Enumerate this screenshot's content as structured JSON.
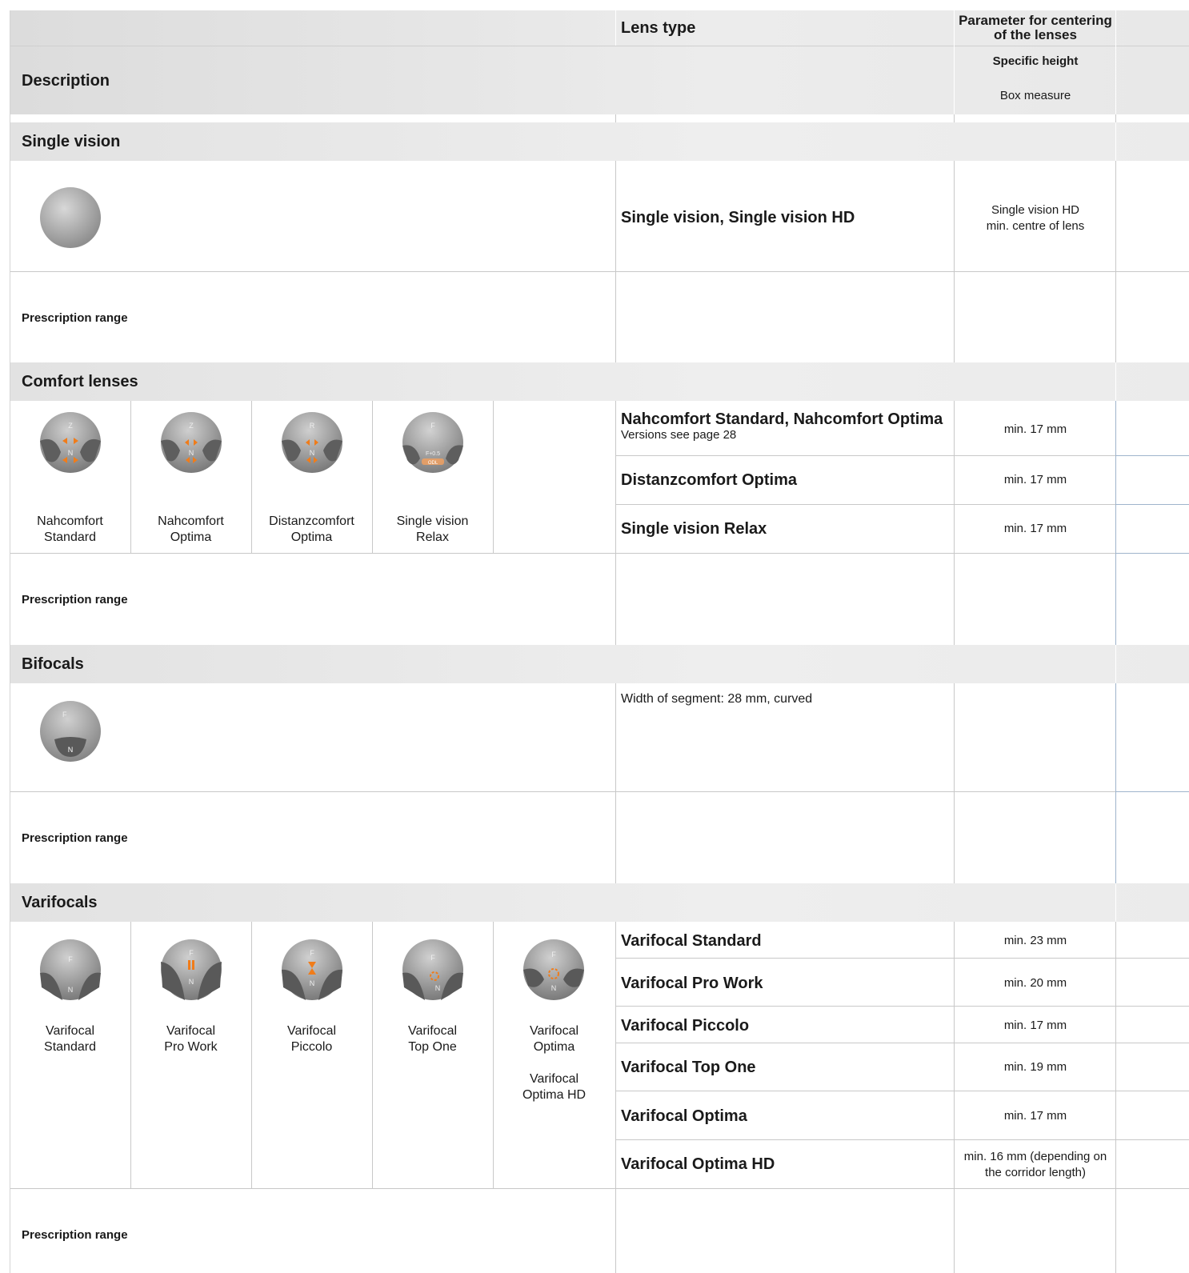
{
  "header": {
    "description": "Description",
    "lens_type": "Lens type",
    "parameter_title": "Parameter for centering of the lenses",
    "parameter_sub1": "Specific height",
    "parameter_sub2": "Box measure"
  },
  "sections": {
    "single_vision": {
      "title": "Single vision",
      "lens": "Single vision, Single vision HD",
      "param_line1": "Single vision HD",
      "param_line2": "min. centre of lens",
      "prescription": "Prescription range"
    },
    "comfort": {
      "title": "Comfort lenses",
      "images": [
        {
          "line1": "Nahcomfort",
          "line2": "Standard",
          "top": "Z",
          "mid": "",
          "bot": "N"
        },
        {
          "line1": "Nahcomfort",
          "line2": "Optima",
          "top": "Z",
          "mid": "",
          "bot": "N"
        },
        {
          "line1": "Distanzcomfort",
          "line2": "Optima",
          "top": "R",
          "mid": "",
          "bot": "N"
        },
        {
          "line1": "Single vision",
          "line2": "Relax",
          "top": "F",
          "mid": "F+0.5",
          "bot": "ODL"
        }
      ],
      "rows": [
        {
          "lens": "Nahcomfort Standard, Nahcomfort Optima",
          "sub": "Versions see page 28",
          "param": "min. 17 mm"
        },
        {
          "lens": "Distanzcomfort Optima",
          "sub": "",
          "param": "min. 17 mm"
        },
        {
          "lens": "Single vision Relax",
          "sub": "",
          "param": "min. 17 mm"
        }
      ],
      "prescription": "Prescription range"
    },
    "bifocals": {
      "title": "Bifocals",
      "note": "Width of segment: 28 mm, curved",
      "icon_top": "F",
      "icon_bot": "N",
      "prescription": "Prescription range"
    },
    "varifocals": {
      "title": "Varifocals",
      "images": [
        {
          "line1": "Varifocal",
          "line2": "Standard",
          "line3": "",
          "line4": ""
        },
        {
          "line1": "Varifocal",
          "line2": "Pro Work",
          "line3": "",
          "line4": ""
        },
        {
          "line1": "Varifocal",
          "line2": "Piccolo",
          "line3": "",
          "line4": ""
        },
        {
          "line1": "Varifocal",
          "line2": "Top One",
          "line3": "",
          "line4": ""
        },
        {
          "line1": "Varifocal",
          "line2": "Optima",
          "line3": "Varifocal",
          "line4": "Optima HD"
        }
      ],
      "rows": [
        {
          "lens": "Varifocal Standard",
          "param": "min. 23 mm"
        },
        {
          "lens": "Varifocal Pro Work",
          "param": "min. 20 mm"
        },
        {
          "lens": "Varifocal Piccolo",
          "param": "min. 17 mm"
        },
        {
          "lens": "Varifocal Top One",
          "param": "min. 19 mm"
        },
        {
          "lens": "Varifocal Optima",
          "param": "min. 17 mm"
        },
        {
          "lens": "Varifocal Optima HD",
          "param": "min. 16 mm (depending on the corridor length)"
        }
      ],
      "prescription": "Prescription range"
    }
  },
  "colors": {
    "band": "#e6e6e6",
    "accent_orange": "#f07c1a",
    "lens_grey": "#a9a9a9"
  }
}
